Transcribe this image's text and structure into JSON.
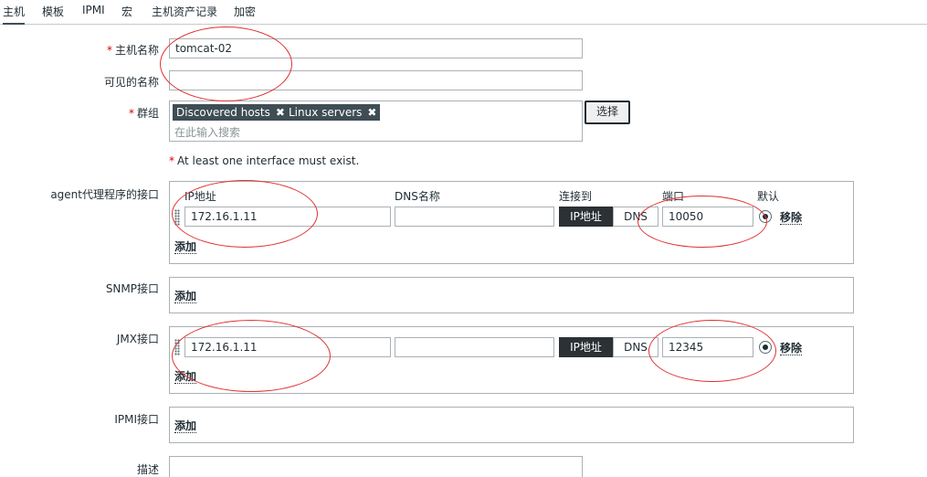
{
  "tabs": [
    "主机",
    "模板",
    "IPMI",
    "宏",
    "主机资产记录",
    "加密"
  ],
  "host": {
    "name_label": "主机名称",
    "name_required": "*",
    "name_value": "tomcat-02",
    "visible_label": "可见的名称",
    "visible_value": "",
    "groups_label": "群组",
    "groups_required": "*",
    "groups": [
      "Discovered hosts",
      "Linux servers"
    ],
    "groups_remove": "✖",
    "groups_placeholder": "在此输入搜索",
    "select_button": "选择",
    "interface_note_star": "*",
    "interface_note": "At least one interface must exist."
  },
  "interfaces": {
    "col_ip": "IP地址",
    "col_dns": "DNS名称",
    "col_connect": "连接到",
    "col_port": "端口",
    "col_default": "默认",
    "seg_ip": "IP地址",
    "seg_dns": "DNS",
    "remove": "移除",
    "add": "添加",
    "agent": {
      "label": "agent代理程序的接口",
      "ip": "172.16.1.11",
      "dns": "",
      "port": "10050"
    },
    "snmp": {
      "label": "SNMP接口"
    },
    "jmx": {
      "label": "JMX接口",
      "ip": "172.16.1.11",
      "dns": "",
      "port": "12345"
    },
    "ipmi": {
      "label": "IPMI接口"
    }
  },
  "description_label": "描述",
  "colors": {
    "annotation": "#e03030",
    "chip": "#3f4d55",
    "segment_active": "#2b3134"
  }
}
